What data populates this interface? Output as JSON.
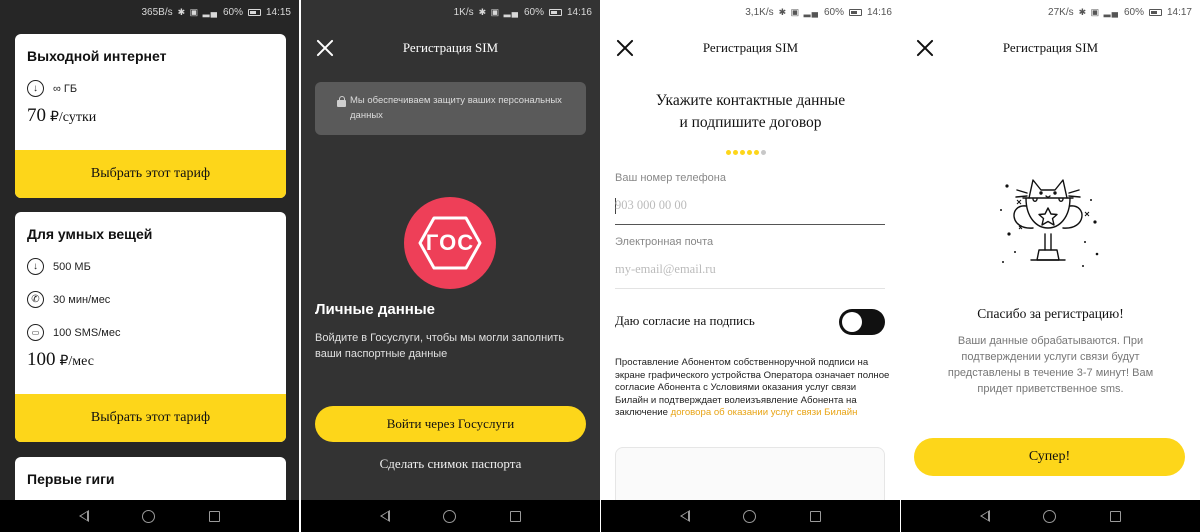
{
  "colors": {
    "accent_yellow": "#fdd61a",
    "dark_bg": "#262626",
    "dark_bg2": "#333333",
    "gos_red": "#ee3f58",
    "link_orange": "#e8a415"
  },
  "screen1": {
    "status": {
      "speed": "365B/s",
      "battery": "60%",
      "time": "14:15"
    },
    "cards": [
      {
        "title": "Выходной интернет",
        "features": [
          {
            "icon": "download-icon",
            "text": "∞ ГБ"
          }
        ],
        "price": "70",
        "unit": "₽/сутки",
        "button": "Выбрать этот тариф"
      },
      {
        "title": "Для умных вещей",
        "features": [
          {
            "icon": "download-icon",
            "text": "500 МБ"
          },
          {
            "icon": "phone-icon",
            "text": "30 мин/мес"
          },
          {
            "icon": "message-icon",
            "text": "100 SMS/мес"
          }
        ],
        "price": "100",
        "unit": "₽/мес",
        "button": "Выбрать этот тариф"
      },
      {
        "title": "Первые гиги"
      }
    ]
  },
  "screen2": {
    "status": {
      "speed": "1K/s",
      "battery": "60%",
      "time": "14:16"
    },
    "title": "Регистрация SIM",
    "notice": "Мы обеспечиваем защиту ваших персональных данных",
    "logo_text": "ГОС",
    "section_title": "Личные данные",
    "section_desc": "Войдите в Госуслуги, чтобы мы могли заполнить ваши паспортные данные",
    "primary_button": "Войти через Госуслуги",
    "secondary_link": "Сделать снимок паспорта"
  },
  "screen3": {
    "status": {
      "speed": "3,1K/s",
      "battery": "60%",
      "time": "14:16"
    },
    "title": "Регистрация SIM",
    "heading_line1": "Укажите контактные данные",
    "heading_line2": "и подпишите договор",
    "progress": {
      "total": 6,
      "completed": 5
    },
    "phone_label": "Ваш номер телефона",
    "phone_placeholder": "903 000 00 00",
    "email_label": "Электронная почта",
    "email_placeholder": "my-email@email.ru",
    "consent_label": "Даю согласие на подпись",
    "consent_on": false,
    "legal_text": "Проставление Абонентом собственноручной подписи на экране графического устройства Оператора означает полное согласие Абонента с Условиями оказания услуг связи Билайн и подтверждает волеизъявление Абонента на заключение ",
    "legal_link": "договора об оказании услуг связи Билайн"
  },
  "screen4": {
    "status": {
      "speed": "27K/s",
      "battery": "60%",
      "time": "14:17"
    },
    "title": "Регистрация SIM",
    "thanks": "Спасибо за регистрацию!",
    "desc": "Ваши данные обрабатываются. При подтверждении услуги связи будут представлены в течение 3-7 минут! Вам придет приветственное sms.",
    "button": "Супер!"
  }
}
